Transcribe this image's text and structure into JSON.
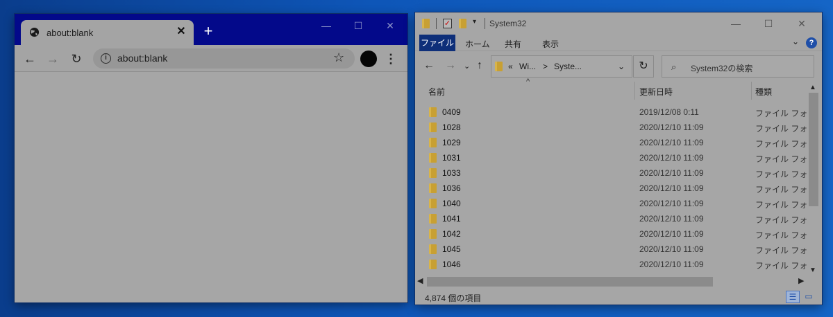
{
  "chrome": {
    "tab": {
      "title": "about:blank",
      "close": "✕",
      "icon": "globe-icon"
    },
    "new_tab": "+",
    "window_controls": {
      "minimize": "—",
      "maximize": "☐",
      "close": "✕"
    },
    "nav": {
      "back": "←",
      "forward": "→",
      "reload": "↻"
    },
    "omnibox": {
      "info": "i",
      "url": "about:blank",
      "bookmark": "☆"
    },
    "menu": "⋮"
  },
  "explorer": {
    "title": "System32",
    "qat_dropdown": "▾",
    "window_controls": {
      "minimize": "—",
      "maximize": "☐",
      "close": "✕"
    },
    "ribbon": {
      "file": "ファイル",
      "tabs": [
        "ホーム",
        "共有",
        "表示"
      ],
      "collapse": "⌄",
      "help": "?"
    },
    "address": {
      "back": "←",
      "forward": "→",
      "recent": "⌄",
      "up": "↑",
      "overflow": "«",
      "crumbs": [
        "Wi...",
        "Syste..."
      ],
      "separator": ">",
      "dropdown": "⌄",
      "refresh": "↻"
    },
    "search": {
      "icon": "⌕",
      "placeholder": "System32の検索"
    },
    "columns": {
      "name": "名前",
      "date": "更新日時",
      "type": "種類",
      "sort": "^"
    },
    "files": [
      {
        "name": "0409",
        "date": "2019/12/08 0:11",
        "type": "ファイル フォルダー"
      },
      {
        "name": "1028",
        "date": "2020/12/10 11:09",
        "type": "ファイル フォルダー"
      },
      {
        "name": "1029",
        "date": "2020/12/10 11:09",
        "type": "ファイル フォルダー"
      },
      {
        "name": "1031",
        "date": "2020/12/10 11:09",
        "type": "ファイル フォルダー"
      },
      {
        "name": "1033",
        "date": "2020/12/10 11:09",
        "type": "ファイル フォルダー"
      },
      {
        "name": "1036",
        "date": "2020/12/10 11:09",
        "type": "ファイル フォルダー"
      },
      {
        "name": "1040",
        "date": "2020/12/10 11:09",
        "type": "ファイル フォルダー"
      },
      {
        "name": "1041",
        "date": "2020/12/10 11:09",
        "type": "ファイル フォルダー"
      },
      {
        "name": "1042",
        "date": "2020/12/10 11:09",
        "type": "ファイル フォルダー"
      },
      {
        "name": "1045",
        "date": "2020/12/10 11:09",
        "type": "ファイル フォルダー"
      },
      {
        "name": "1046",
        "date": "2020/12/10 11:09",
        "type": "ファイル フォルダー"
      }
    ],
    "scroll": {
      "up": "▲",
      "down": "▼",
      "left": "◀",
      "right": "▶"
    },
    "status": "4,874 個の項目",
    "views": {
      "details": "☰",
      "large_icons": "▭"
    }
  },
  "colors": {
    "desktop": "#0e56b8",
    "chrome_titlebar": "#03098a",
    "ribbon_file_tab": "#0e2f79",
    "folder": "#c8a033",
    "dim_surface": "#a6a6a6"
  }
}
